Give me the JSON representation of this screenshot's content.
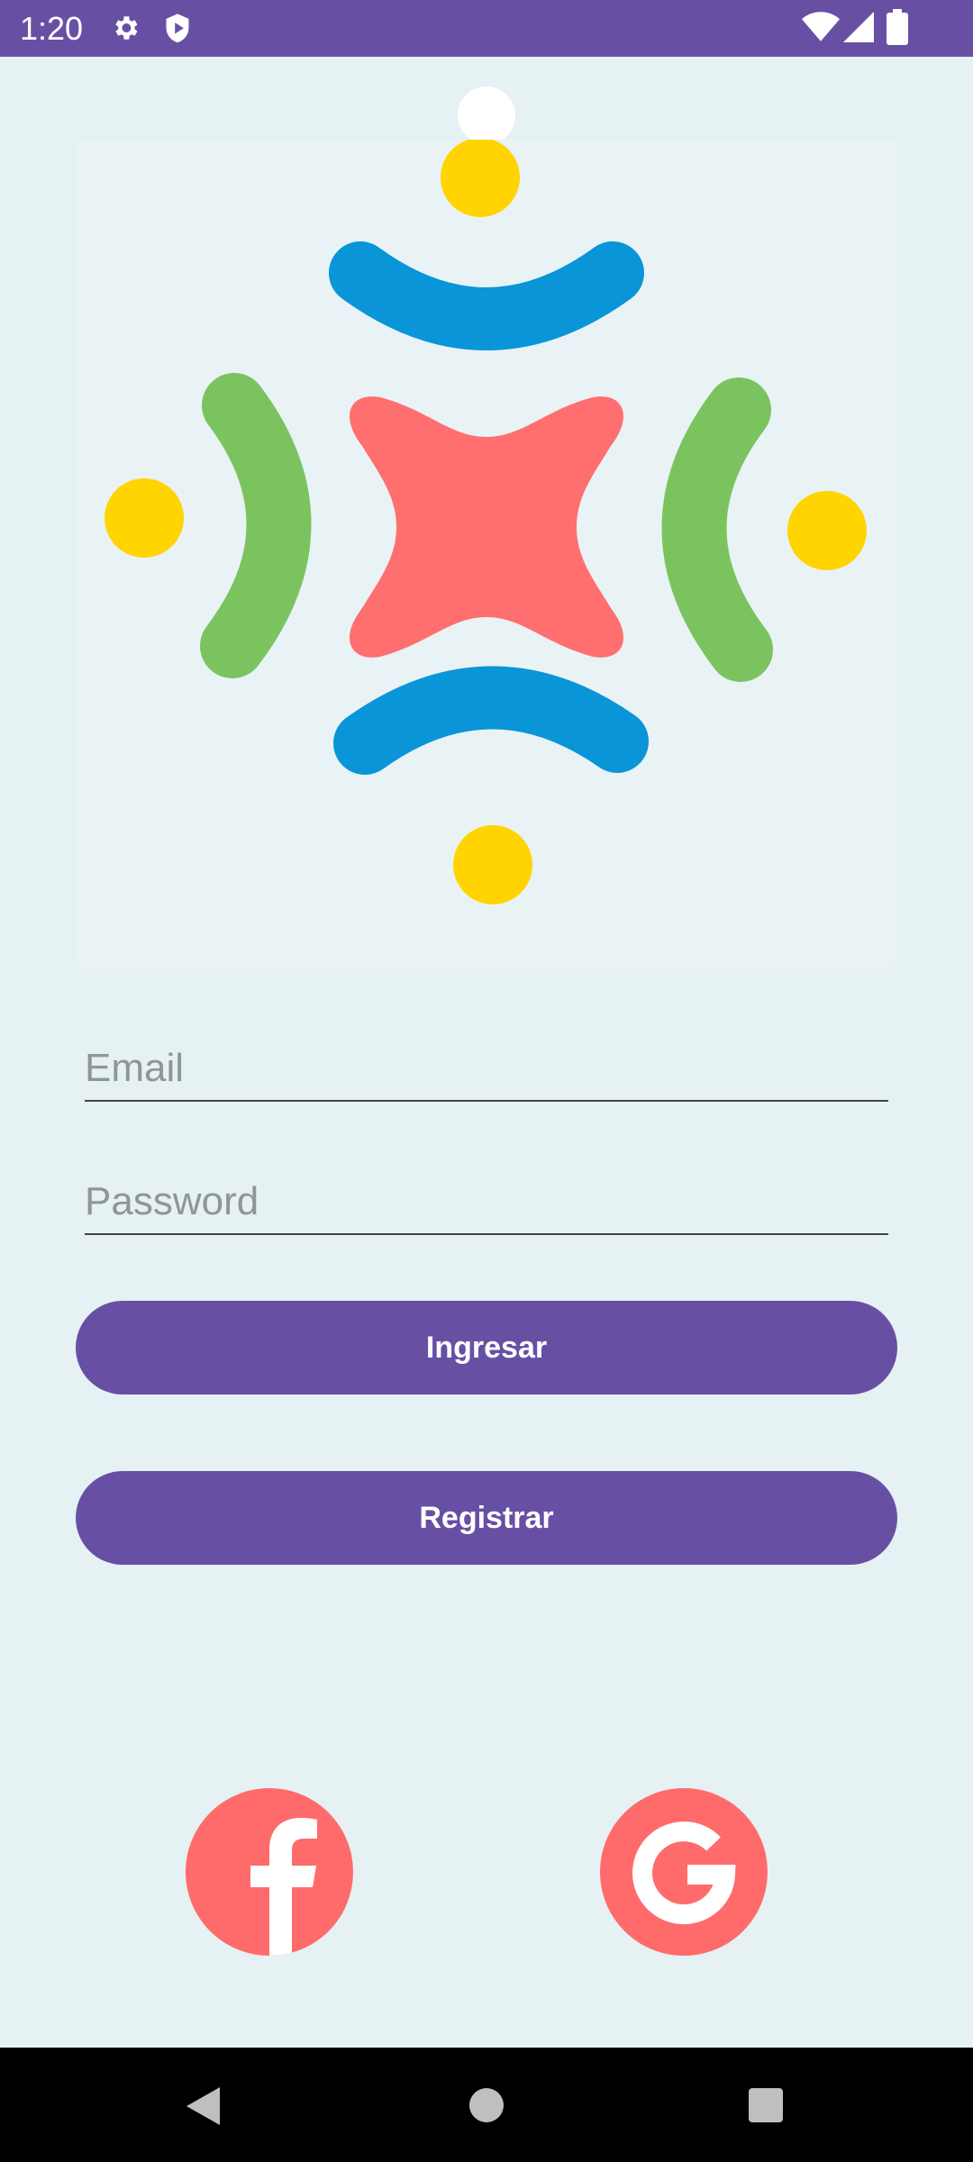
{
  "status_bar": {
    "time": "1:20",
    "icons": [
      "gear-icon",
      "shield-play-icon",
      "wifi-icon",
      "signal-icon",
      "battery-icon"
    ]
  },
  "theme": {
    "primary": "#6750A4",
    "background": "#E6F1F3",
    "accent_red": "#FF6B6B",
    "logo_blue": "#0A95D8",
    "logo_green": "#7BC35F",
    "logo_yellow": "#FFD400"
  },
  "login": {
    "email_placeholder": "Email",
    "password_placeholder": "Password",
    "login_button": "Ingresar",
    "register_button": "Registrar"
  },
  "social": {
    "facebook_icon": "facebook-icon",
    "google_icon": "google-icon"
  },
  "navigation": {
    "back_icon": "back-triangle-icon",
    "home_icon": "home-circle-icon",
    "recents_icon": "recents-square-icon"
  }
}
